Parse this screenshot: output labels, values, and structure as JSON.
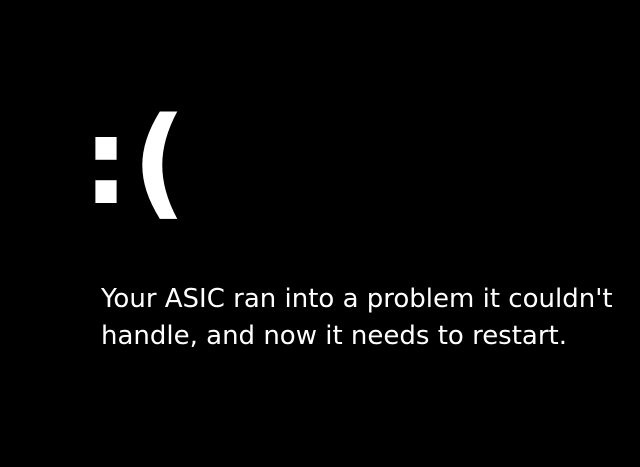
{
  "screen": {
    "emoticon": ":(",
    "message": "Your ASIC ran into a problem it couldn't handle, and now it needs to restart.",
    "background_color": "#000000",
    "text_color": "#ffffff"
  }
}
